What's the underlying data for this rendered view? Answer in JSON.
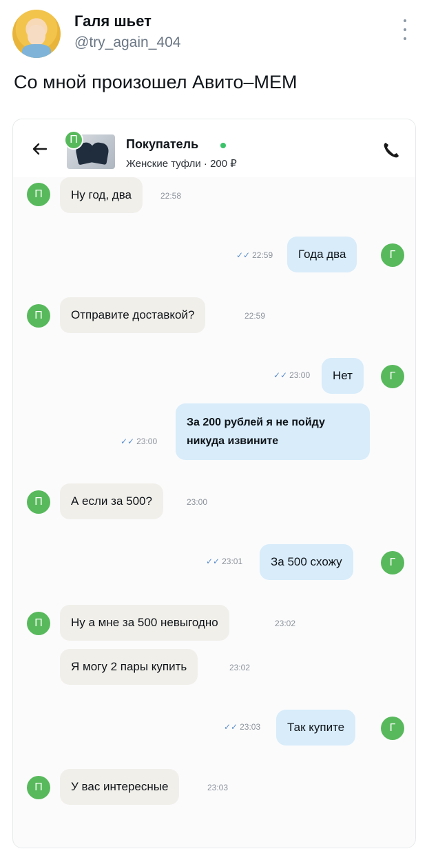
{
  "tweet": {
    "author_name": "Галя шьет",
    "author_handle": "@try_again_404",
    "text": "Со мной произошел Авито–МЕМ"
  },
  "chat": {
    "header": {
      "contact_name": "Покупатель",
      "item_line": "Женские туфли · 200 ₽",
      "avatar_letter": "П"
    },
    "seller_letter": "Г",
    "ticks_glyph": "✓✓",
    "messages": [
      {
        "side": "in",
        "text": "Ну год, два",
        "time": "22:58"
      },
      {
        "side": "out",
        "text": "Года два",
        "time": "22:59"
      },
      {
        "side": "in",
        "text": "Отправите доставкой?",
        "time": "22:59"
      },
      {
        "side": "out",
        "text": "Нет",
        "time": "23:00"
      },
      {
        "side": "out",
        "text": "За 200 рублей я не пойду никуда извините",
        "time": "23:00"
      },
      {
        "side": "in",
        "text": "А если за 500?",
        "time": "23:00"
      },
      {
        "side": "out",
        "text": "За 500 схожу",
        "time": "23:01"
      },
      {
        "side": "in",
        "text": "Ну а мне за 500 невыгодно",
        "time": "23:02"
      },
      {
        "side": "in",
        "text": "Я могу 2 пары купить",
        "time": "23:02"
      },
      {
        "side": "out",
        "text": "Так купите",
        "time": "23:03"
      },
      {
        "side": "in",
        "text": "У вас интересные",
        "time": "23:03"
      }
    ]
  }
}
